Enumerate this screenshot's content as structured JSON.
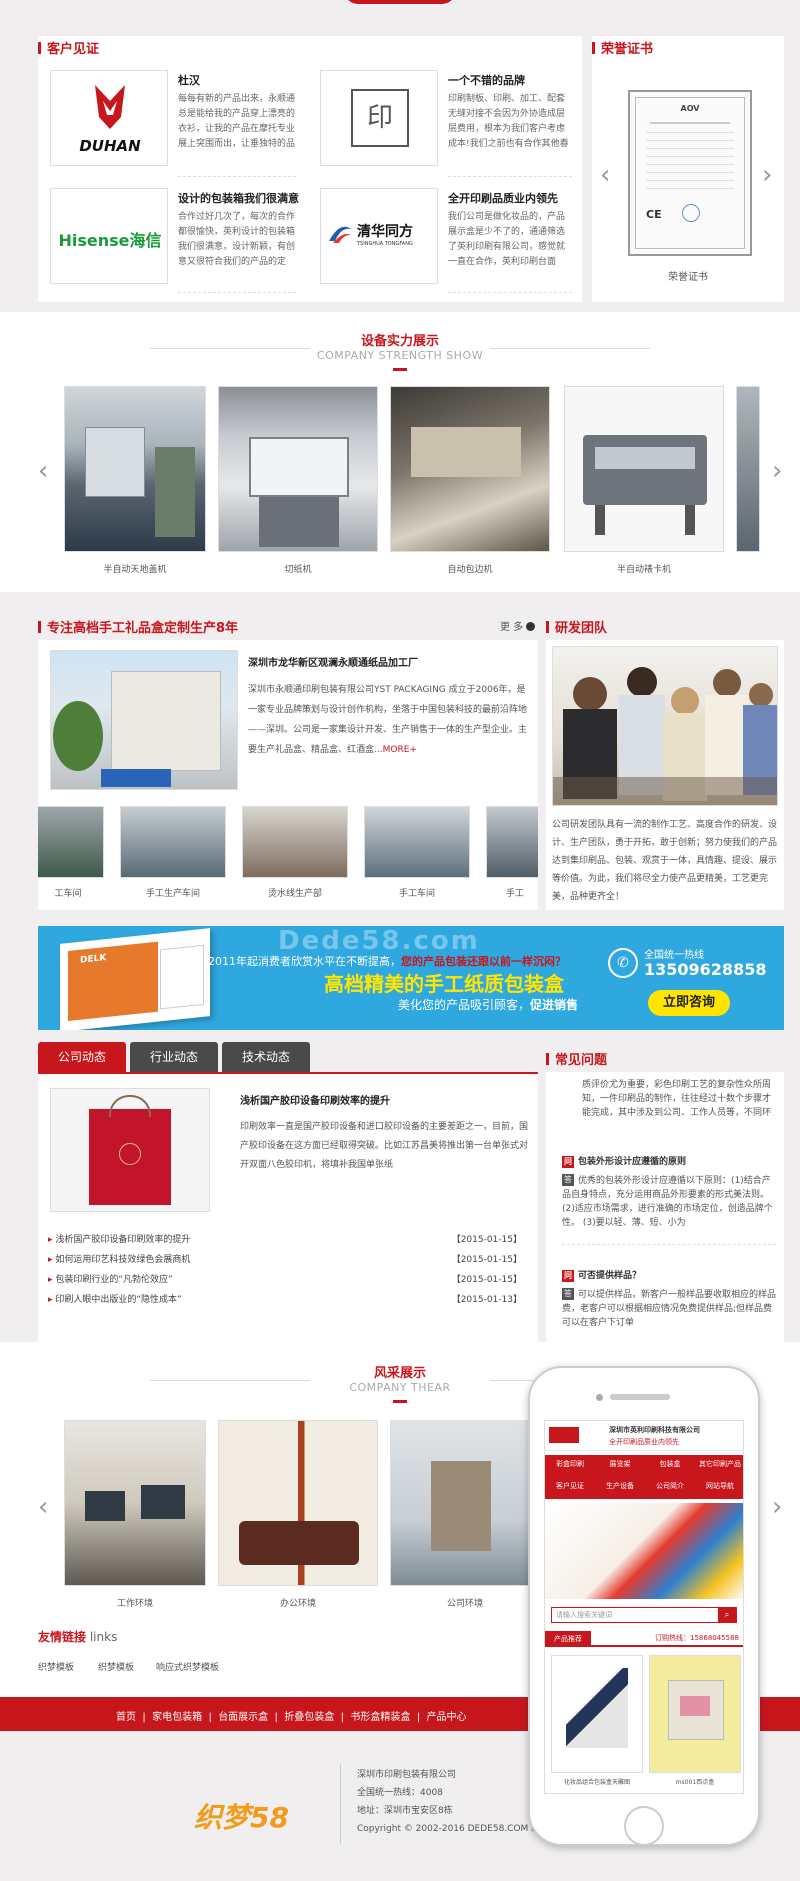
{
  "testimonials": {
    "title": "客户见证",
    "items": [
      {
        "name": "杜汉",
        "logo": "DUHAN",
        "desc": "每每有新的产品出来，永顺通总是能给我的产品穿上漂亮的衣衫，让我的产品在摩托专业展上突围而出，让垂独特的品"
      },
      {
        "name": "一个不错的品牌",
        "logo": "印",
        "desc": "印刷制板、印刷、加工、配套无缝对接不会因为外协造成层层费用，根本为我们客户考虑成本!我们之前也有合作其他春"
      },
      {
        "name": "设计的包装箱我们很满意",
        "logo": "Hisense海信",
        "desc": "合作过好几次了，每次的合作都很愉快，英利设计的包装箱我们很满意，设计新颖，有创意又很符合我们的产品的定"
      },
      {
        "name": "全开印刷品质业内领先",
        "logo": "清华同方",
        "logo_en": "TSINGHUA TONGFANG",
        "desc": "我们公司是做化妆品的，产品展示盒是少不了的，通通筛选了英利印刷有限公司，感觉就一直在合作，英利印刷台面"
      }
    ]
  },
  "honor": {
    "title": "荣誉证书",
    "caption": "荣誉证书",
    "cert_brand": "AOV"
  },
  "equipment": {
    "title_cn": "设备实力展示",
    "title_en": "COMPANY STRENGTH SHOW",
    "items": [
      {
        "caption": "半自动天地盖机"
      },
      {
        "caption": "切纸机"
      },
      {
        "caption": "自动包边机"
      },
      {
        "caption": "半自动裱卡机"
      }
    ]
  },
  "about": {
    "title": "专注高档手工礼品盒定制生产8年",
    "more": "更 多",
    "company_name": "深圳市龙华新区观澜永顺通纸品加工厂",
    "desc": "深圳市永顺通印刷包装有限公司YST PACKAGING 成立于2006年，是一家专业品牌策划与设计创作机构，坐落于中国包装科技的最前沿阵地——深圳。公司是一家集设计开发、生产销售于一体的生产型企业。主要生产礼品盒、精品盒、红酒盒...",
    "more_link": "MORE+",
    "gallery": [
      {
        "caption": "工车间"
      },
      {
        "caption": "手工生产车间"
      },
      {
        "caption": "烫水线生产部"
      },
      {
        "caption": "手工车间"
      },
      {
        "caption": "手工"
      }
    ]
  },
  "rd": {
    "title": "研发团队",
    "desc": "公司研发团队具有一流的制作工艺、高度合作的研发、设计、生产团队，勇于开拓，敢于创新；努力使我们的产品达到集印刷品、包装、观赏于一体，具情趣、提设、展示等价值。为此，我们将尽全力使产品更精美，工艺更完美，品种更齐全！"
  },
  "banner": {
    "watermark": "Dede58.com",
    "line1": "2011年起消费者欣赏水平在不断提高，",
    "line1_red": "您的产品包装还跟以前一样沉闷？",
    "headline": "高档精美的手工纸质包装盒",
    "line3": "美化您的产品吸引顾客，",
    "line3_bold": "促进销售",
    "hotline_label": "全国统一热线",
    "phone": "13509628858",
    "cta": "立即咨询",
    "box_text": "DELK"
  },
  "news": {
    "tabs": [
      "公司动态",
      "行业动态",
      "技术动态"
    ],
    "featured_title": "浅析国产胶印设备印刷效率的提升",
    "featured_desc": "印刷效率一直是国产胶印设备和进口胶印设备的主要差距之一，目前，国产胶印设备在这方面已经取得突破。比如江苏昌美将推出第一台单张式对开双面八色胶印机，将填补我国单张纸",
    "items": [
      {
        "title": "浅析国产胶印设备印刷效率的提升",
        "date": "【2015-01-15】"
      },
      {
        "title": "如何运用印艺科技效绿色会展商机",
        "date": "【2015-01-15】"
      },
      {
        "title": "包装印刷行业的“凡勃伦效应”",
        "date": "【2015-01-15】"
      },
      {
        "title": "印刷人眼中出版业的“隐性成本”",
        "date": "【2015-01-13】"
      }
    ]
  },
  "faq": {
    "title": "常见问题",
    "intro": "质评价尤为重要，彩色印刷工艺的复杂性众所周知，一件印刷品的制作，往往经过十数个步骤才能完成，其中涉及到公司、工作人员等，不同环",
    "items": [
      {
        "q_badge": "问",
        "q": "包装外形设计应遵循的原则",
        "a_badge": "答",
        "a": "优秀的包装外形设计应遵循以下原则：(1)结合产品自身特点，充分运用商品外形要素的形式美法则。(2)适应市场需求，进行准确的市场定位，创造品牌个性。 (3)要以轻、薄、短、小为"
      },
      {
        "q_badge": "问",
        "q": "可否提供样品？",
        "a_badge": "答",
        "a": "可以提供样品，新客户一般样品要收取相应的样品费，老客户可以根据相应情况免费提供样品;但样品费可以在客户下订单"
      }
    ]
  },
  "gallery2": {
    "title_cn": "风采展示",
    "title_en": "COMPANY THEAR",
    "items": [
      {
        "caption": "工作环境"
      },
      {
        "caption": "办公环境"
      },
      {
        "caption": "公司环境"
      }
    ]
  },
  "links": {
    "title_red": "友情链接",
    "title_gray": "links",
    "items": [
      "织梦模板",
      "织梦模板",
      "响应式织梦模板"
    ]
  },
  "footer": {
    "nav": [
      "首页",
      "家电包装箱",
      "台面展示盒",
      "折叠包装盒",
      "书形盒精装盒",
      "产品中心"
    ],
    "logo_text": "织梦58",
    "company": "深圳市印刷包装有限公司",
    "hotline": "全国统一热线：4008",
    "address": "地址：深圳市宝安区8栋",
    "copyright": "Copyright © 2002-2016 DEDE58.COM 织"
  },
  "phone_mock": {
    "company": "深圳市英利印刷科技有限公司",
    "slogan": "全开印刷品质业内领先",
    "nav": [
      "彩盒印刷",
      "展览架",
      "包装盒",
      "其它印刷产品",
      "客户见证",
      "生产设备",
      "公司简介",
      "网站导航"
    ],
    "search_placeholder": "请输入搜索关键词",
    "products_label": "产品推荐",
    "hotline": "订购热线：15868045588",
    "products": [
      {
        "caption": "化妆品组合包装盒天雕图"
      },
      {
        "caption": "ms001西点盒"
      }
    ]
  },
  "colors": {
    "accent": "#c8161d",
    "banner_bg": "#2fa8e0"
  }
}
